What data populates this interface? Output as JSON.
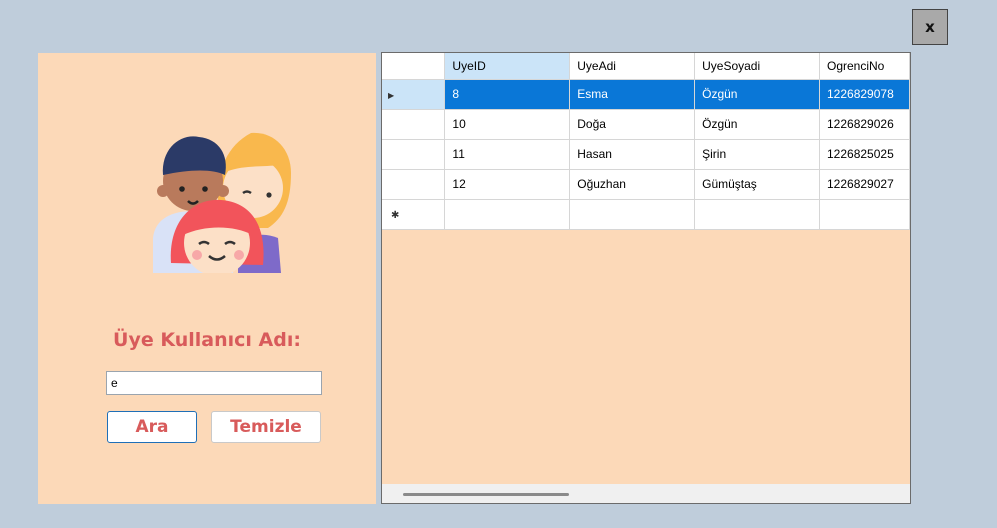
{
  "close_button": {
    "label": "x"
  },
  "search_panel": {
    "label": "Üye Kullanıcı Adı:",
    "input_value": "e",
    "search_button": "Ara",
    "clear_button": "Temizle"
  },
  "grid": {
    "columns": [
      "UyeID",
      "UyeAdi",
      "UyeSoyadi",
      "OgrenciNo"
    ],
    "rows": [
      {
        "cells": [
          "8",
          "Esma",
          "Özgün",
          "1226829078"
        ],
        "selected": true
      },
      {
        "cells": [
          "10",
          "Doğa",
          "Özgün",
          "1226829026"
        ],
        "selected": false
      },
      {
        "cells": [
          "11",
          "Hasan",
          "Şirin",
          "1226825025"
        ],
        "selected": false
      },
      {
        "cells": [
          "12",
          "Oğuzhan",
          "Gümüştaş",
          "1226829027"
        ],
        "selected": false
      }
    ],
    "current_row_indicator": "▶",
    "new_row_indicator": "✱"
  },
  "colors": {
    "background": "#BFCDDB",
    "panel": "#FCD9B8",
    "accent_text": "#D85B5B",
    "selection": "#0A77D7",
    "header_highlight": "#CBE4F8"
  },
  "icons": {
    "avatar": "kids-group-avatar"
  }
}
